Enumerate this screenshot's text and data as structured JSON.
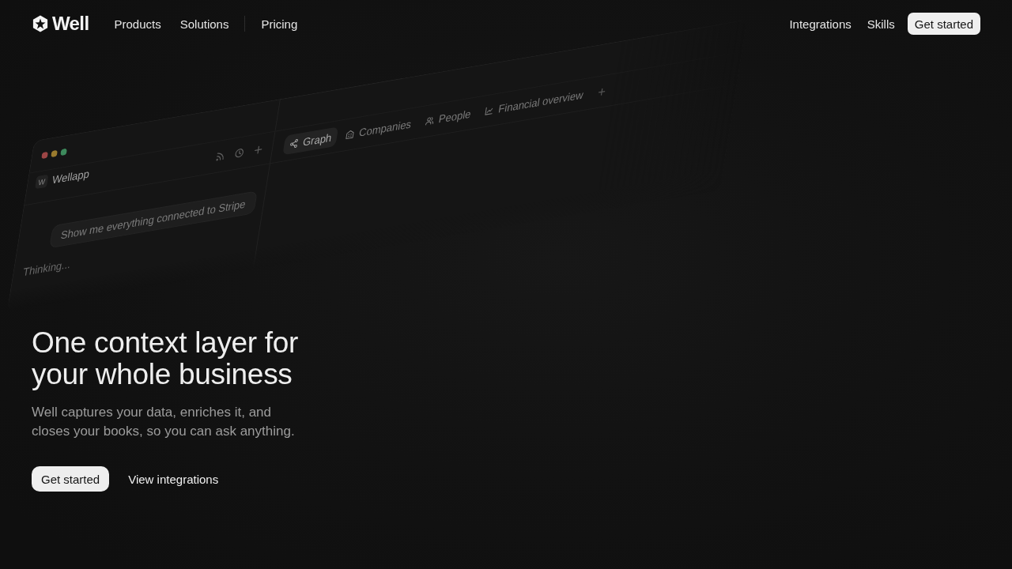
{
  "nav": {
    "logo": "Well",
    "link_groups": [
      {
        "links": [
          {
            "label": "Products"
          },
          {
            "label": "Solutions"
          }
        ]
      },
      {
        "links": [
          {
            "label": "Pricing"
          }
        ]
      }
    ],
    "right_links": [
      {
        "label": "Integrations"
      },
      {
        "label": "Skills"
      }
    ],
    "cta": "Get started"
  },
  "app_preview": {
    "sidebar": {
      "workspace_initial": "W",
      "workspace": "Wellapp",
      "prompt": "Show me everything connected to Stripe",
      "status": "Thinking..."
    },
    "tabs": [
      {
        "label": "Graph",
        "kind": "graph",
        "selected": true
      },
      {
        "label": "Companies",
        "kind": "companies",
        "selected": false
      },
      {
        "label": "People",
        "kind": "people",
        "selected": false
      },
      {
        "label": "Financial overview",
        "kind": "chart",
        "selected": false
      }
    ]
  },
  "hero": {
    "title": "One context layer for your whole business",
    "subtitle": "Well captures your data, enriches it, and closes your books, so you can ask anything.",
    "primary_button": "Get started",
    "secondary_link": "View integrations"
  }
}
